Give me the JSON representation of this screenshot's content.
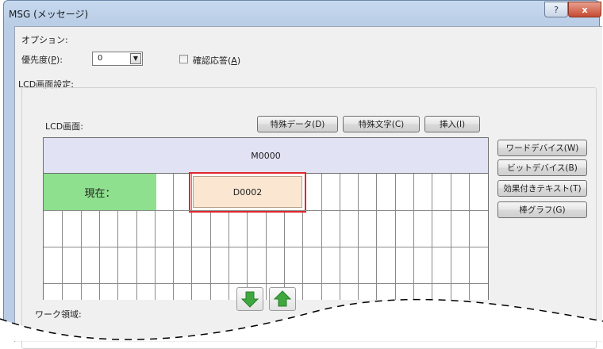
{
  "window": {
    "title": "MSG (メッセージ)",
    "help_label": "?",
    "close_label": "x"
  },
  "options": {
    "section_label": "オプション:",
    "priority_label_pre": "優先度(",
    "priority_key": "P",
    "priority_label_post": "):",
    "priority_value": "0",
    "confirm_label_pre": "確認応答(",
    "confirm_key": "A",
    "confirm_label_post": ")",
    "confirm_checked": false
  },
  "lcd": {
    "group_label": "LCD画面設定:",
    "screen_label": "LCD画面:",
    "buttons": {
      "special_data": "特殊データ(D)",
      "special_char": "特殊文字(C)",
      "insert": "挿入(I)"
    },
    "side_buttons": [
      "ワードデバイス(W)",
      "ビットデバイス(B)",
      "効果付きテキスト(T)",
      "棒グラフ(G)"
    ],
    "row1_device": "M0000",
    "row2_label": "現在：",
    "row2_device": "D0002"
  },
  "work_area_label": "ワーク領域:",
  "colors": {
    "highlight": "#e0262b",
    "green_cell": "#8ee08e",
    "beige_cell": "#fbe7d1",
    "top_row": "#e2e2f5",
    "arrow_green": "#3ea83e"
  },
  "icons": {
    "down": "arrow-down-icon",
    "up": "arrow-up-icon"
  }
}
